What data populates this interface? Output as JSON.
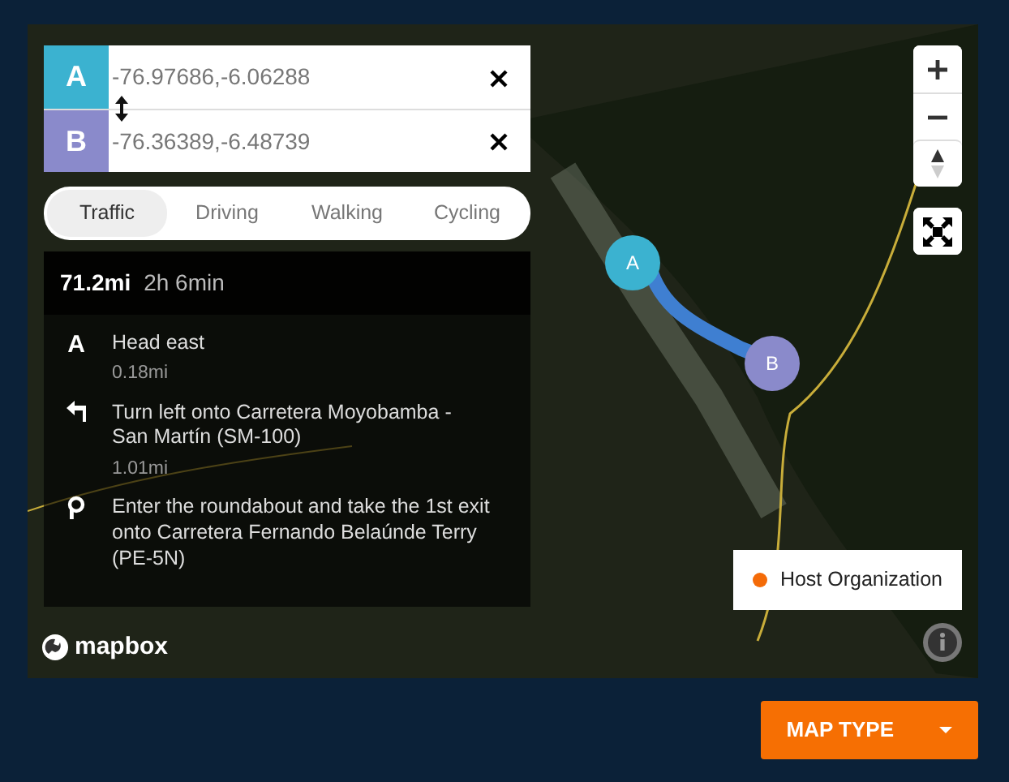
{
  "waypoints": [
    {
      "label": "A",
      "value": "-76.97686,-6.06288",
      "color": "#3bb2d0"
    },
    {
      "label": "B",
      "value": "-76.36389,-6.48739",
      "color": "#8a8acb"
    }
  ],
  "profiles": [
    {
      "label": "Traffic",
      "selected": true
    },
    {
      "label": "Driving",
      "selected": false
    },
    {
      "label": "Walking",
      "selected": false
    },
    {
      "label": "Cycling",
      "selected": false
    }
  ],
  "summary": {
    "distance": "71.2mi",
    "duration": "2h 6min"
  },
  "steps": [
    {
      "kind": "depart",
      "icon_label": "A",
      "instruction": "Head east",
      "distance": "0.18mi"
    },
    {
      "kind": "left",
      "instruction": "Turn left onto Carretera Moyobamba - San Martín (SM-100)",
      "distance": "1.01mi"
    },
    {
      "kind": "roundabout",
      "instruction": "Enter the roundabout and take the 1st exit onto Carretera Fernando Belaúnde Terry (PE-5N)"
    }
  ],
  "markers": [
    {
      "label": "A",
      "color": "#3bb2d0"
    },
    {
      "label": "B",
      "color": "#8a8acb"
    }
  ],
  "legend": [
    {
      "label": "Host Organization",
      "color": "#f46b08"
    }
  ],
  "attribution": "mapbox",
  "map_type_button": "MAP TYPE"
}
